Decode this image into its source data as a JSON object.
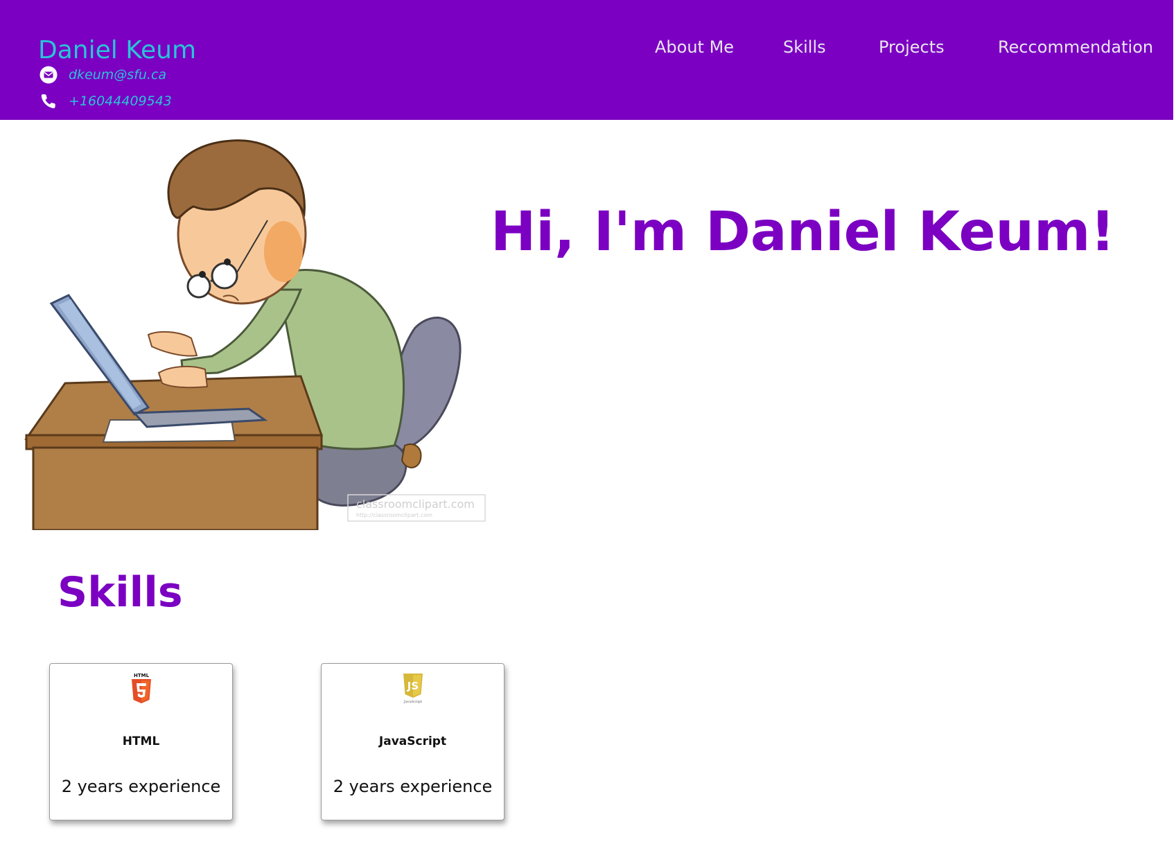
{
  "header": {
    "name": "Daniel Keum",
    "email": "dkeum@sfu.ca",
    "phone": "+16044409543",
    "nav": [
      {
        "label": "About Me"
      },
      {
        "label": "Skills"
      },
      {
        "label": "Projects"
      },
      {
        "label": "Reccommendation"
      }
    ]
  },
  "hero": {
    "title": "Hi, I'm Daniel Keum!",
    "watermark": "classroomclipart.com",
    "watermark_url": "http://classroomclipart.com"
  },
  "skills": {
    "heading": "Skills",
    "items": [
      {
        "name": "HTML",
        "experience": "2 years experience",
        "logo_text": "HTML"
      },
      {
        "name": "JavaScript",
        "experience": "2 years experience",
        "logo_text": "JavaScript"
      }
    ]
  },
  "colors": {
    "header_bg": "#7b00c2",
    "brand_text": "#29c4d8",
    "nav_text": "#eae6f0",
    "heading": "#7b00c2"
  }
}
